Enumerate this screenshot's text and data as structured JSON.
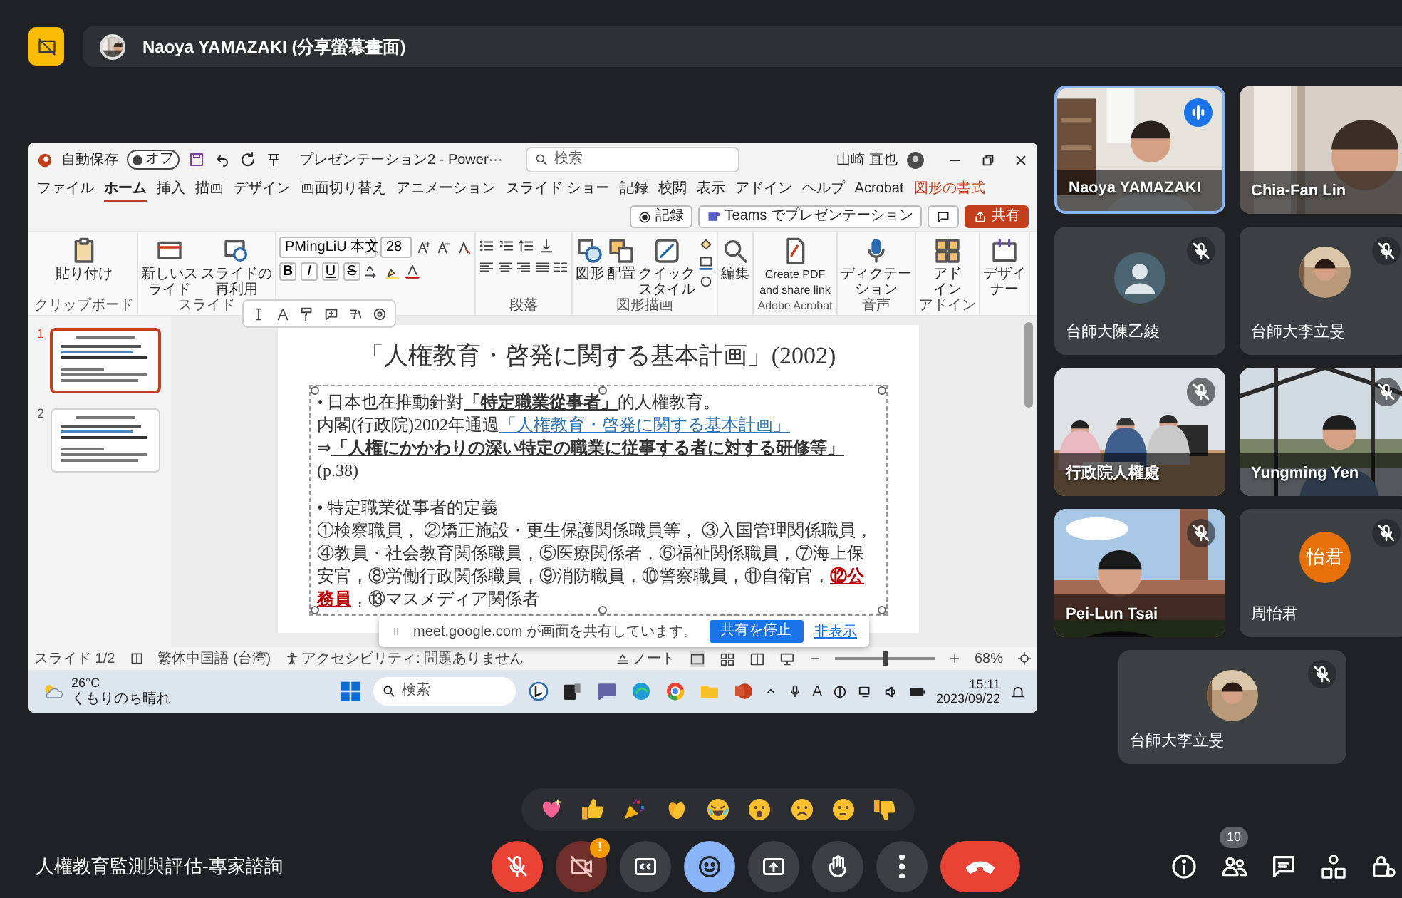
{
  "presenter_banner": {
    "label": "Naoya YAMAZAKI (分享螢幕畫面)"
  },
  "shared_screen": {
    "title_bar": {
      "autosave_label": "自動保存",
      "autosave": {
        "label": "オフ",
        "on": false
      },
      "document_title": "プレゼンテーション2 - Power···",
      "search": {
        "placeholder": "検索"
      },
      "user": "山崎 直也"
    },
    "tabs": [
      {
        "label": "ファイル",
        "kind": "normal",
        "selected": false
      },
      {
        "label": "ホーム",
        "kind": "normal",
        "selected": true
      },
      {
        "label": "挿入",
        "kind": "normal",
        "selected": false
      },
      {
        "label": "描画",
        "kind": "normal",
        "selected": false
      },
      {
        "label": "デザイン",
        "kind": "normal",
        "selected": false
      },
      {
        "label": "画面切り替え",
        "kind": "normal",
        "selected": false
      },
      {
        "label": "アニメーション",
        "kind": "normal",
        "selected": false
      },
      {
        "label": "スライド ショー",
        "kind": "normal",
        "selected": false
      },
      {
        "label": "記録",
        "kind": "normal",
        "selected": false
      },
      {
        "label": "校閲",
        "kind": "normal",
        "selected": false
      },
      {
        "label": "表示",
        "kind": "normal",
        "selected": false
      },
      {
        "label": "アドイン",
        "kind": "normal",
        "selected": false
      },
      {
        "label": "ヘルプ",
        "kind": "normal",
        "selected": false
      },
      {
        "label": "Acrobat",
        "kind": "normal",
        "selected": false
      },
      {
        "label": "図形の書式",
        "kind": "contextual",
        "selected": false
      }
    ],
    "tab_buttons": [
      {
        "kind": "record",
        "label": "記録"
      },
      {
        "kind": "teams",
        "label": "Teams でプレゼンテーション"
      },
      {
        "kind": "comment"
      },
      {
        "kind": "share",
        "label": "共有"
      }
    ],
    "ribbon": [
      {
        "kind": "clipboard",
        "label": "クリップボード",
        "items": [
          "貼り付け"
        ]
      },
      {
        "kind": "slides",
        "label": "スライド",
        "items": [
          "新しいスライド",
          "スライドの再利用"
        ]
      },
      {
        "kind": "font",
        "font": "PMingLiU 本文",
        "size": "28",
        "styles": [
          "B",
          "I",
          "U",
          "S"
        ]
      },
      {
        "kind": "paragraph",
        "label": "段落"
      },
      {
        "kind": "drawing",
        "label": "図形描画",
        "items": [
          "図形",
          "配置",
          "クイックスタイル"
        ]
      },
      {
        "kind": "editing",
        "items": [
          "編集"
        ]
      },
      {
        "kind": "acrobat",
        "label": "Adobe Acrobat",
        "items": [
          "Create PDF and share link"
        ]
      },
      {
        "kind": "voice",
        "label": "音声",
        "items": [
          "ディクテーション"
        ]
      },
      {
        "kind": "addins",
        "label": "アドイン",
        "items": [
          "アドイン"
        ]
      },
      {
        "kind": "designer",
        "items": [
          "デザイナー"
        ]
      }
    ],
    "slides": [
      {
        "number": "1",
        "selected": true
      },
      {
        "number": "2",
        "selected": false
      }
    ],
    "slide": {
      "title": "「人権教育・啓発に関する基本計画」(2002)",
      "paragraphs": [
        {
          "runs": [
            {
              "text": "• 日本也在推動針對",
              "kind": "plain"
            },
            {
              "text": "「特定職業從事者」",
              "kind": "bold"
            },
            {
              "text": "的人權教育。",
              "kind": "plain"
            }
          ]
        },
        {
          "runs": [
            {
              "text": "内閣(行政院)2002年通過",
              "kind": "plain"
            },
            {
              "text": "「人権教育・啓発に関する基本計画」",
              "kind": "link"
            }
          ]
        },
        {
          "runs": [
            {
              "text": "⇒",
              "kind": "plain"
            },
            {
              "text": "「人権にかかわりの深い特定の職業に従事する者に対する研修等」",
              "kind": "bold"
            },
            {
              "text": "(p.38)",
              "kind": "plain"
            }
          ]
        },
        {
          "runs": [
            {
              "text": "• 特定職業從事者的定義",
              "kind": "plain"
            }
          ]
        },
        {
          "runs": [
            {
              "text": "①検察職員， ②矯正施設・更生保護関係職員等， ③入国管理関係職員，④教員・社会教育関係職員，⑤医療関係者，⑥福祉関係職員，⑦海上保安官，⑧労働行政関係職員，⑨消防職員，⑩警察職員，⑪自衛官，",
              "kind": "plain"
            },
            {
              "text": "⑫公務員",
              "kind": "alert"
            },
            {
              "text": "，⑬マスメディア関係者",
              "kind": "plain"
            }
          ]
        }
      ]
    },
    "share_notice": {
      "message": "meet.google.com が画面を共有しています。",
      "stop_button": "共有を停止",
      "hide_link": "非表示"
    },
    "status_bar": {
      "slide": "スライド 1/2",
      "language": "繁体中国語 (台湾)",
      "accessibility": "アクセシビリティ: 問題ありません",
      "notes": "ノート",
      "zoom_slider": {
        "level": 0.5
      },
      "zoom": "68%"
    },
    "taskbar": {
      "temperature": "26°C",
      "weather": "くもりのち晴れ",
      "search": {
        "placeholder": "検索"
      },
      "input_indicator": "A",
      "time": "15:11",
      "date": "2023/09/22"
    }
  },
  "participants": [
    {
      "name": "Naoya YAMAZAKI",
      "kind": "video",
      "muted": false,
      "speaking": true
    },
    {
      "name": "Chia-Fan Lin",
      "kind": "video",
      "muted": false,
      "speaking": false
    },
    {
      "name": "台師大陳乙綾",
      "kind": "avatar",
      "muted": true,
      "speaking": false
    },
    {
      "name": "台師大李立旻",
      "muted": true,
      "speaking": false
    },
    {
      "name": "行政院人權處",
      "kind": "video",
      "muted": true,
      "speaking": false
    },
    {
      "name": "Yungming Yen",
      "kind": "video",
      "muted": true,
      "speaking": false
    },
    {
      "name": "Pei-Lun Tsai",
      "kind": "video",
      "muted": true,
      "speaking": false
    },
    {
      "name": "周怡君",
      "kind": "initials",
      "initials": "怡君",
      "color": "#e8710a",
      "muted": true,
      "speaking": false
    },
    {
      "name": "台師大李立旻",
      "muted": true,
      "speaking": false
    }
  ],
  "meeting_title": "人權教育監測與評估-專家諮詢",
  "controls": [
    {
      "kind": "mic",
      "on": false
    },
    {
      "kind": "camera",
      "on": false,
      "badge": "!"
    },
    {
      "kind": "captions",
      "on": false
    },
    {
      "kind": "reactions",
      "on": true
    },
    {
      "kind": "present",
      "on": false
    },
    {
      "kind": "hand",
      "on": false
    },
    {
      "kind": "more"
    },
    {
      "kind": "leave"
    }
  ],
  "side_buttons": [
    {
      "kind": "info"
    },
    {
      "kind": "people",
      "badge": "10"
    },
    {
      "kind": "chat"
    },
    {
      "kind": "activities"
    },
    {
      "kind": "host_controls"
    }
  ]
}
